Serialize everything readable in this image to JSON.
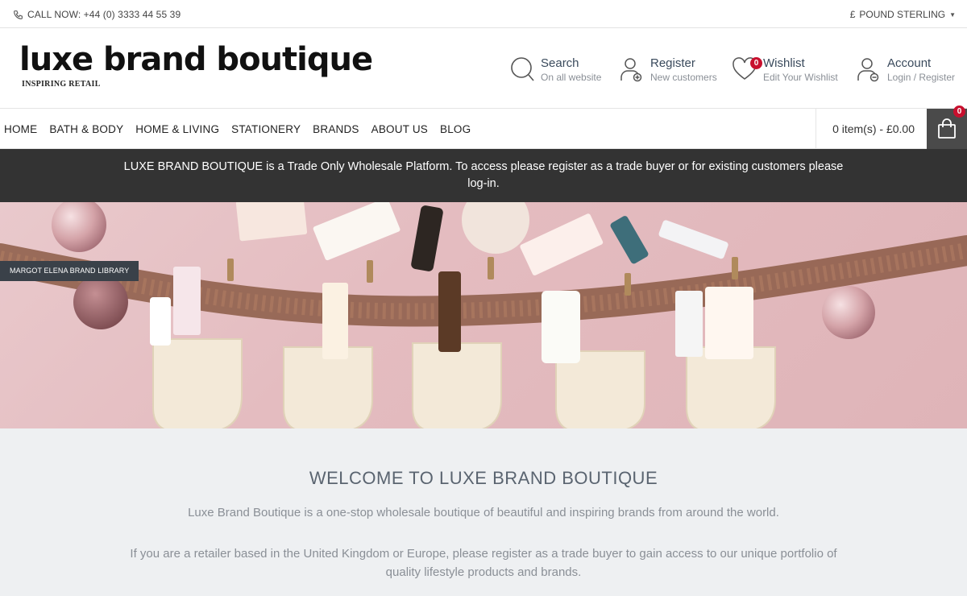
{
  "topbar": {
    "call_label": "CALL NOW: +44 (0) 3333 44 55 39",
    "currency_symbol": "£",
    "currency_label": "POUND STERLING"
  },
  "header": {
    "logo_text": "luxe brand boutique",
    "logo_tagline": "INSPIRING RETAIL",
    "search": {
      "title": "Search",
      "sub": "On all website"
    },
    "register": {
      "title": "Register",
      "sub": "New customers"
    },
    "wishlist": {
      "title": "Wishlist",
      "sub": "Edit Your Wishlist",
      "count": "0"
    },
    "account": {
      "title": "Account",
      "sub": "Login / Register"
    }
  },
  "nav": {
    "items": [
      "HOME",
      "BATH & BODY",
      "HOME & LIVING",
      "STATIONERY",
      "BRANDS",
      "ABOUT US",
      "BLOG"
    ],
    "cart_label": "0 item(s) - £0.00",
    "cart_count": "0"
  },
  "notice": {
    "text": "LUXE BRAND BOUTIQUE is a Trade Only Wholesale Platform. To access please register as a trade buyer or for existing customers please log-in."
  },
  "hero": {
    "brand_tag": "MARGOT ELENA BRAND LIBRARY"
  },
  "welcome": {
    "title": "WELCOME TO LUXE BRAND BOUTIQUE",
    "p1": "Luxe Brand Boutique is a one-stop wholesale boutique of beautiful and inspiring brands from around the world.",
    "p2": "If you are a retailer based in the United Kingdom or Europe, please register as a trade buyer to gain access to our unique portfolio of quality lifestyle products and brands."
  },
  "colors": {
    "notice_bg": "#333333",
    "badge": "#c8102e",
    "cart_button": "#4a4a4a",
    "hero_bg": "#e4bcc0",
    "welcome_bg": "#eef0f2"
  }
}
